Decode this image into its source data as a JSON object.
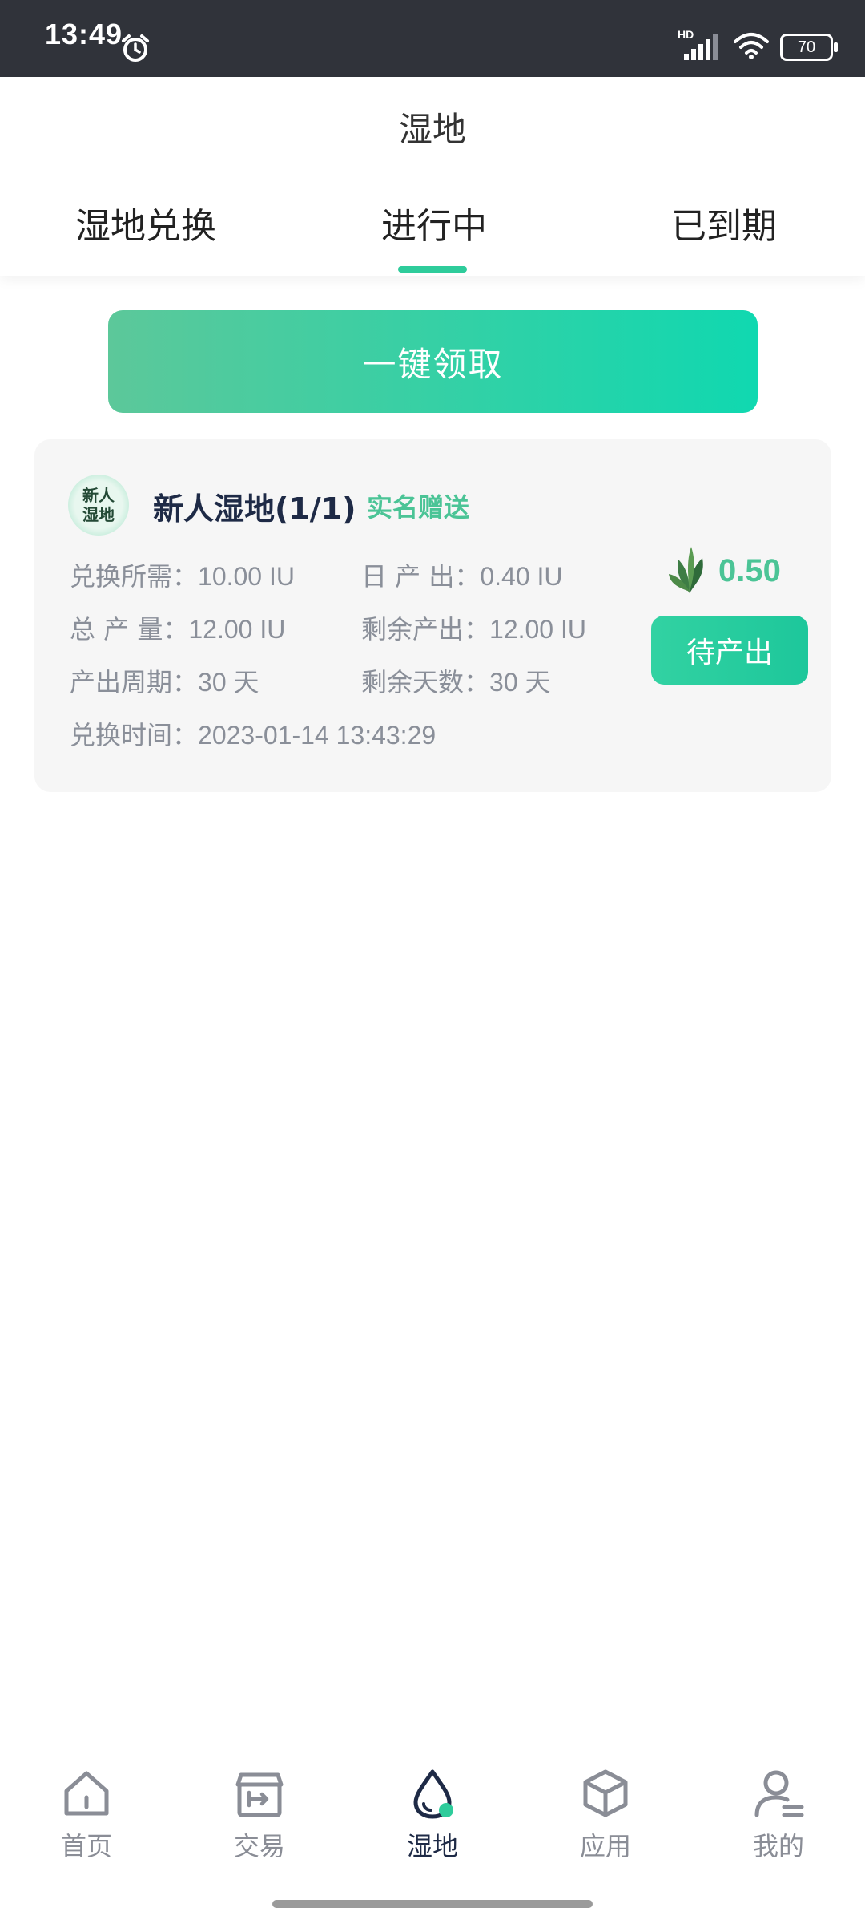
{
  "status_bar": {
    "time": "13:49",
    "network_label": "HD",
    "battery": "70",
    "icons": [
      "alarm-icon",
      "signal-icon",
      "wifi-icon",
      "battery-icon"
    ]
  },
  "header": {
    "title": "湿地",
    "tabs": [
      {
        "label": "湿地兑换",
        "active": false
      },
      {
        "label": "进行中",
        "active": true
      },
      {
        "label": "已到期",
        "active": false
      }
    ],
    "accent_color": "#2ecc9b"
  },
  "claim_button": {
    "label": "一键领取"
  },
  "card": {
    "avatar_text_line1": "新人",
    "avatar_text_line2": "湿地",
    "title": "新人湿地(1/1)",
    "tag": "实名赠送",
    "fields": {
      "exchange_required_label": "兑换所需：",
      "exchange_required_value": "10.00 IU",
      "daily_output_label": "日 产 出：",
      "daily_output_value": "0.40 IU",
      "total_output_label": "总 产 量：",
      "total_output_value": "12.00 IU",
      "remaining_output_label": "剩余产出：",
      "remaining_output_value": "12.00 IU",
      "cycle_label": "产出周期：",
      "cycle_value": "30 天",
      "remaining_days_label": "剩余天数：",
      "remaining_days_value": "30 天",
      "exchange_time_label": "兑换时间：",
      "exchange_time_value": "2023-01-14 13:43:29"
    },
    "amount": "0.50",
    "status_button": "待产出",
    "icon": "leaf-icon"
  },
  "bottom_nav": {
    "items": [
      {
        "label": "首页",
        "icon": "home-icon",
        "active": false
      },
      {
        "label": "交易",
        "icon": "trade-icon",
        "active": false
      },
      {
        "label": "湿地",
        "icon": "water-drop-icon",
        "active": true
      },
      {
        "label": "应用",
        "icon": "cube-icon",
        "active": false
      },
      {
        "label": "我的",
        "icon": "user-icon",
        "active": false
      }
    ]
  }
}
